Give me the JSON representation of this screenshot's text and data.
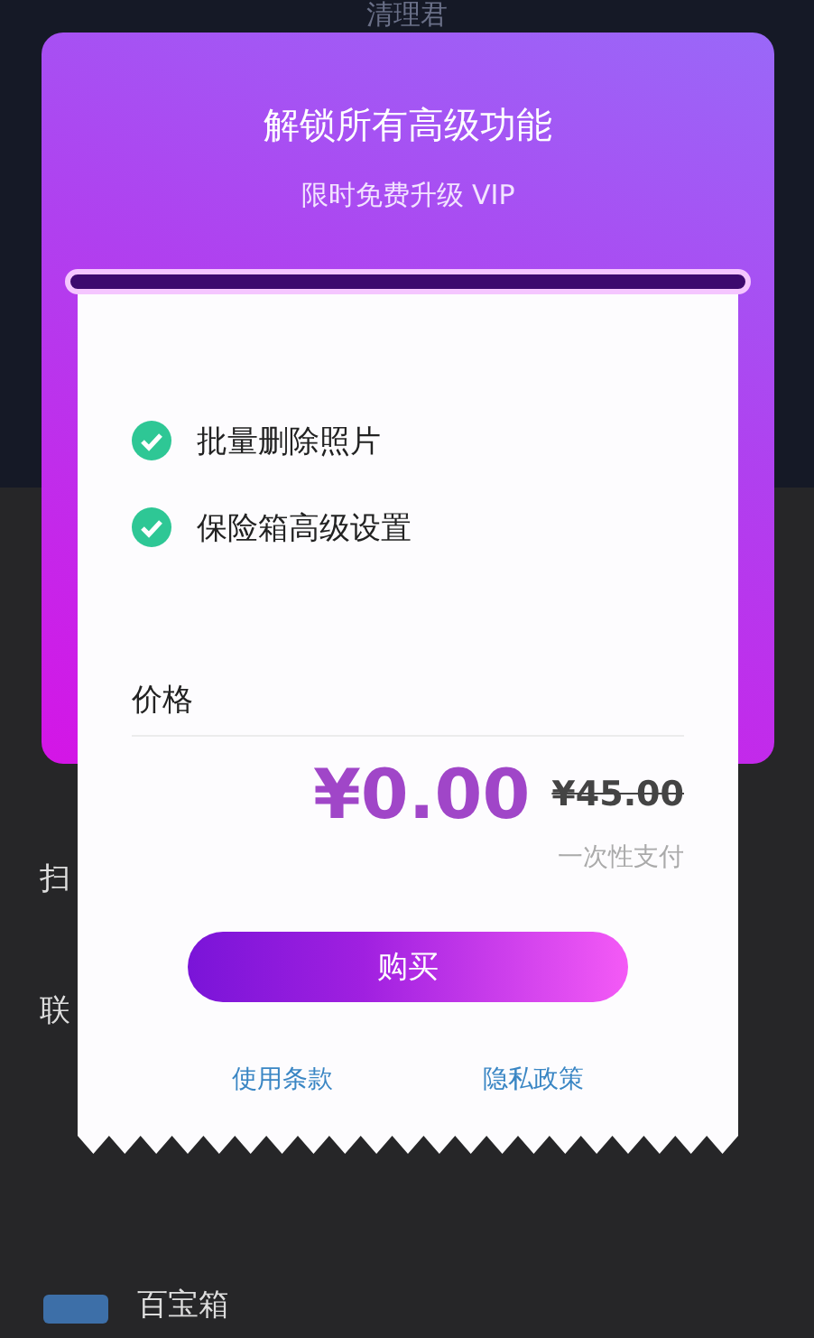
{
  "background": {
    "title": "清理君",
    "rows": [
      {
        "label": "扫"
      },
      {
        "label": "联"
      },
      {
        "label": "百宝箱"
      }
    ]
  },
  "dialog": {
    "title": "解锁所有高级功能",
    "subtitle": "限时免费升级 VIP",
    "features": [
      {
        "label": "批量删除照片",
        "checked": true
      },
      {
        "label": "保险箱高级设置",
        "checked": true
      }
    ],
    "price_label": "价格",
    "price": "¥0.00",
    "original_price": "¥45.00",
    "payment_note": "一次性支付",
    "buy_button": "购买",
    "links": [
      "使用条款",
      "隐私政策"
    ]
  }
}
